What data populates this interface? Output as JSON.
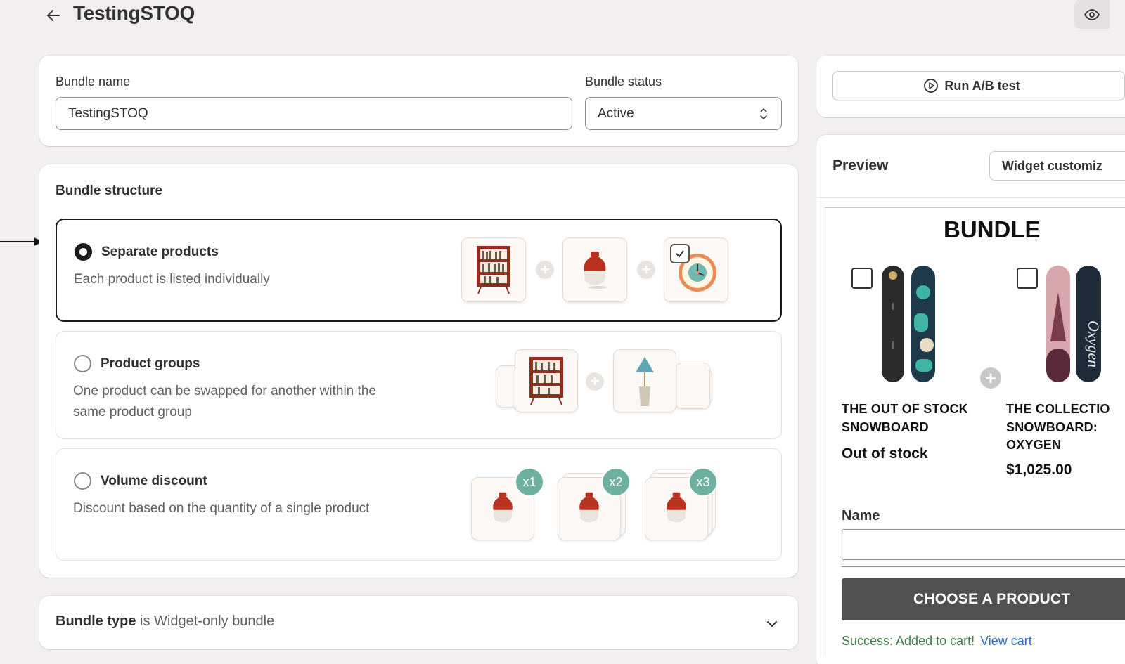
{
  "header": {
    "title": "TestingSTOQ"
  },
  "bundle_name": {
    "label": "Bundle name",
    "value": "TestingSTOQ"
  },
  "bundle_status": {
    "label": "Bundle status",
    "selected": "Active"
  },
  "structure": {
    "title": "Bundle structure",
    "options": [
      {
        "title": "Separate products",
        "description": "Each product is listed individually",
        "selected": true
      },
      {
        "title": "Product groups",
        "description_line1": "One product can be swapped for another within the",
        "description_line2": "same product group",
        "selected": false
      },
      {
        "title": "Volume discount",
        "description": "Discount based on the quantity of a single product",
        "selected": false
      }
    ],
    "quantity_badges": [
      "x1",
      "x2",
      "x3"
    ]
  },
  "bundle_type": {
    "label": "Bundle type",
    "connector": "is",
    "value": "Widget-only bundle"
  },
  "right_panel": {
    "ab_test_label": "Run A/B test",
    "preview_label": "Preview",
    "widget_button_label": "Widget customiz",
    "widget": {
      "heading": "BUNDLE",
      "products": [
        {
          "name_line1": "THE OUT OF STOCK",
          "name_line2": "SNOWBOARD",
          "price": "Out of stock"
        },
        {
          "name_line1": "THE COLLECTIO",
          "name_line2": "SNOWBOARD:",
          "name_line3": "OXYGEN",
          "price": "$1,025.00"
        }
      ],
      "name_label": "Name",
      "choose_button": "CHOOSE A PRODUCT",
      "success_text": "Success: Added to cart!",
      "view_cart": "View cart"
    }
  },
  "colors": {
    "background": "#f1efef",
    "accent_teal": "#6fb1a0",
    "primary_text": "#303030",
    "success_green": "#3b7a45",
    "link_blue": "#2c6ecb"
  }
}
